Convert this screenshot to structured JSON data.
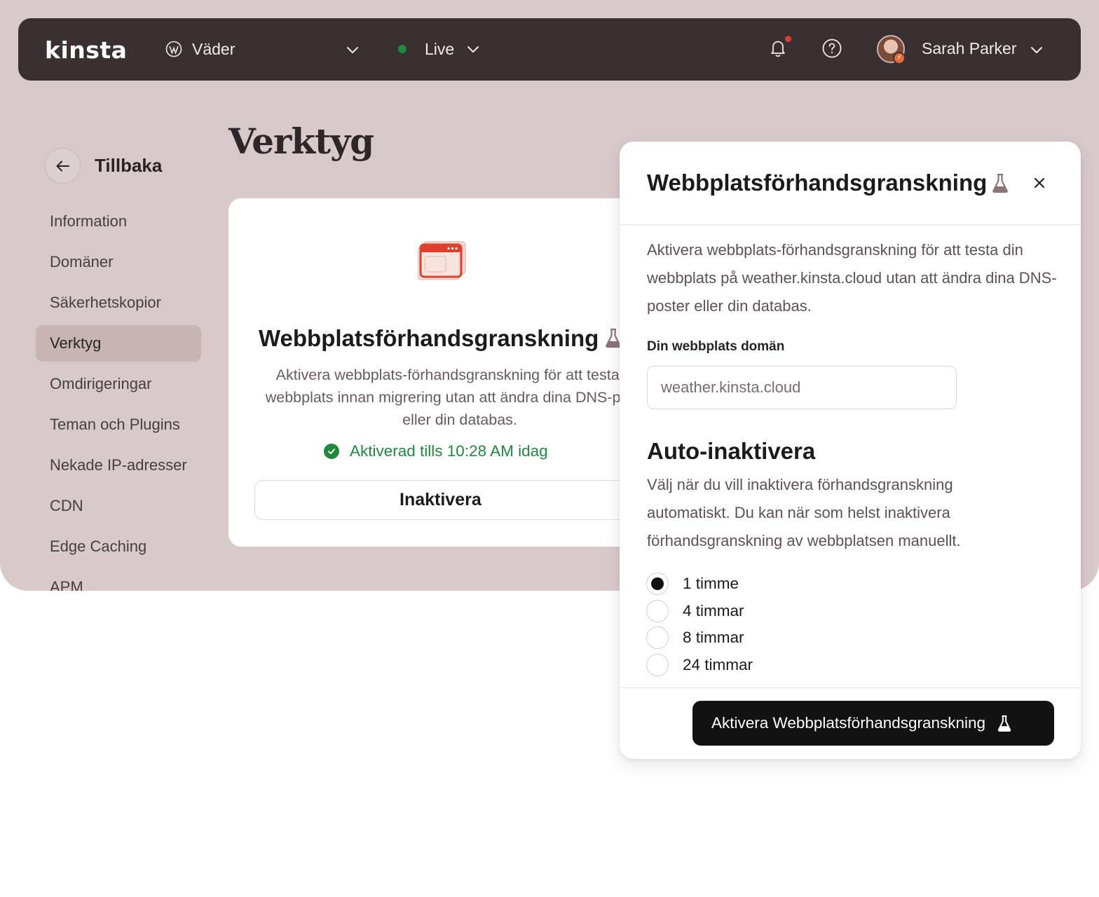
{
  "topbar": {
    "logo": "kinsta",
    "site_name": "Väder",
    "environment": "Live",
    "environment_color": "#1e8a3e",
    "user_name": "Sarah Parker",
    "icons": [
      "wordpress-icon",
      "chevron-down-icon",
      "bell-icon",
      "help-icon",
      "avatar",
      "chevron-down-icon"
    ]
  },
  "back": {
    "label": "Tillbaka"
  },
  "sidebar": {
    "items": [
      {
        "label": "Information",
        "active": false
      },
      {
        "label": "Domäner",
        "active": false
      },
      {
        "label": "Säkerhetskopior",
        "active": false
      },
      {
        "label": "Verktyg",
        "active": true
      },
      {
        "label": "Omdirigeringar",
        "active": false
      },
      {
        "label": "Teman och Plugins",
        "active": false
      },
      {
        "label": "Nekade IP-adresser",
        "active": false
      },
      {
        "label": "CDN",
        "active": false
      },
      {
        "label": "Edge Caching",
        "active": false
      },
      {
        "label": "APM",
        "active": false
      }
    ]
  },
  "page": {
    "title": "Verktyg"
  },
  "tool_card": {
    "title": "Webbplatsförhandsgranskning",
    "description": "Aktivera webbplats-förhandsgranskning för att testa din webbplats innan migrering utan att ändra dina DNS-poster eller din databas.",
    "status": "Aktiverad tills 10:28 AM idag",
    "button_label": "Inaktivera"
  },
  "modal": {
    "title": "Webbplatsförhandsgranskning",
    "description": "Aktivera webbplats-förhandsgranskning för att testa din webbplats på weather.kinsta.cloud utan att ändra dina DNS-poster eller din databas.",
    "domain_label": "Din webbplats domän",
    "domain_value": "weather.kinsta.cloud",
    "auto_title": "Auto-inaktivera",
    "auto_description": "Välj när du vill inaktivera förhandsgranskning automatiskt. Du kan när som helst inaktivera förhandsgranskning av webbplatsen manuellt.",
    "options": [
      {
        "label": "1 timme",
        "checked": true
      },
      {
        "label": "4 timmar",
        "checked": false
      },
      {
        "label": "8 timmar",
        "checked": false
      },
      {
        "label": "24 timmar",
        "checked": false
      }
    ],
    "submit_label": "Aktivera Webbplatsförhandsgranskning"
  },
  "colors": {
    "background": "#d8cacb",
    "topbar": "#3a3032",
    "active_nav": "#c8b5b3",
    "success": "#1e8a3e",
    "primary_button": "#121212",
    "illustration_accent": "#e0402a"
  }
}
